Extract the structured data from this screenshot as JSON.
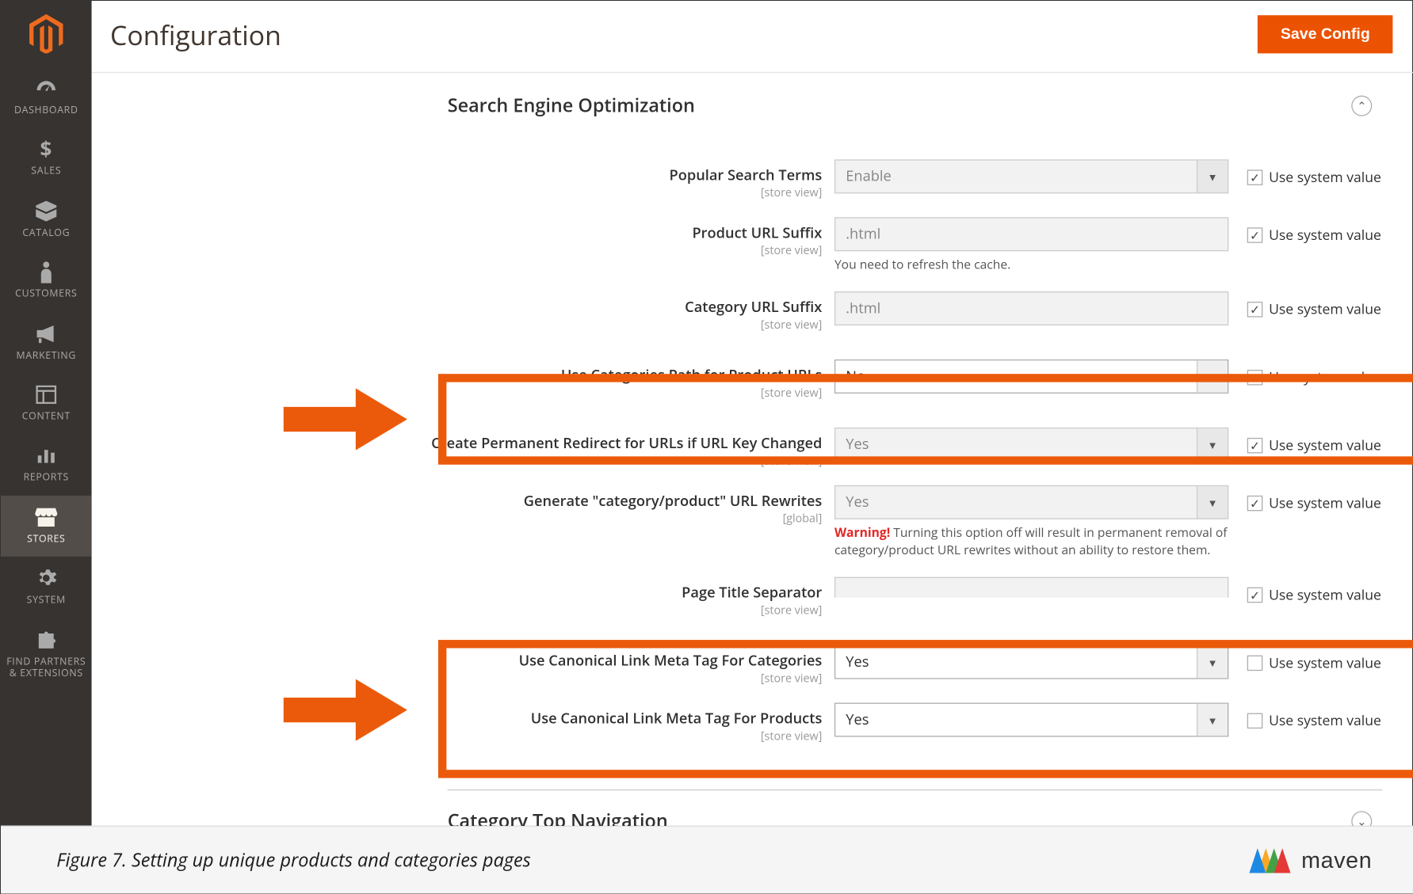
{
  "page": {
    "title": "Configuration",
    "save": "Save Config"
  },
  "sidebar": {
    "items": [
      {
        "label": "DASHBOARD"
      },
      {
        "label": "SALES"
      },
      {
        "label": "CATALOG"
      },
      {
        "label": "CUSTOMERS"
      },
      {
        "label": "MARKETING"
      },
      {
        "label": "CONTENT"
      },
      {
        "label": "REPORTS"
      },
      {
        "label": "STORES"
      },
      {
        "label": "SYSTEM"
      },
      {
        "label": "FIND PARTNERS & EXTENSIONS"
      }
    ]
  },
  "sections": {
    "seo": {
      "title": "Search Engine Optimization"
    },
    "catnav": {
      "title": "Category Top Navigation"
    }
  },
  "lbl": {
    "scope_sv": "[store view]",
    "scope_global": "[global]",
    "use_system": "Use system value"
  },
  "fields": {
    "popular": {
      "label": "Popular Search Terms",
      "value": "Enable",
      "sys": true
    },
    "product_suffix": {
      "label": "Product URL Suffix",
      "value": ".html",
      "note": "You need to refresh the cache.",
      "sys": true
    },
    "category_suffix": {
      "label": "Category URL Suffix",
      "value": ".html",
      "sys": true
    },
    "cat_path": {
      "label": "Use Categories Path for Product URLs",
      "value": "No",
      "sys": false
    },
    "redirect": {
      "label": "Create Permanent Redirect for URLs if URL Key Changed",
      "value": "Yes",
      "sys": true
    },
    "gen_rewrites": {
      "label": "Generate \"category/product\" URL Rewrites",
      "value": "Yes",
      "warn": "Warning!",
      "note": " Turning this option off will result in permanent removal of category/product URL rewrites without an ability to restore them.",
      "sys": true
    },
    "title_sep": {
      "label": "Page Title Separator",
      "value": "",
      "sys": true
    },
    "canon_cat": {
      "label": "Use Canonical Link Meta Tag For Categories",
      "value": "Yes",
      "sys": false
    },
    "canon_prod": {
      "label": "Use Canonical Link Meta Tag For Products",
      "value": "Yes",
      "sys": false
    }
  },
  "caption": "Figure 7. Setting up unique products and categories pages",
  "brand": "maven"
}
